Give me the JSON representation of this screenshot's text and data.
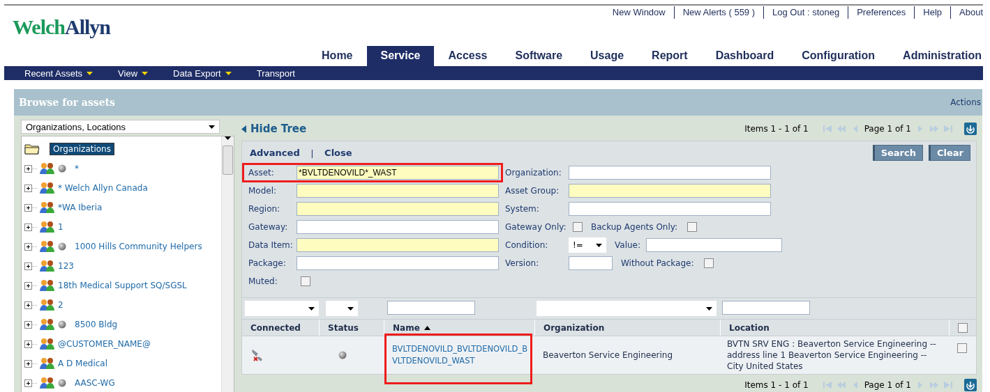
{
  "logo": [
    "Welch",
    "Allyn"
  ],
  "top_links": [
    "New Window",
    "New Alerts ( 559 )",
    "Log Out : stoneg",
    "Preferences",
    "Help",
    "About"
  ],
  "main_nav": [
    {
      "label": "Home",
      "selected": false
    },
    {
      "label": "Service",
      "selected": true
    },
    {
      "label": "Access",
      "selected": false
    },
    {
      "label": "Software",
      "selected": false
    },
    {
      "label": "Usage",
      "selected": false
    },
    {
      "label": "Report",
      "selected": false
    },
    {
      "label": "Dashboard",
      "selected": false
    },
    {
      "label": "Configuration",
      "selected": false
    },
    {
      "label": "Administration",
      "selected": false
    }
  ],
  "sub_nav": [
    {
      "label": "Recent Assets",
      "dropdown": true
    },
    {
      "label": "View",
      "dropdown": true
    },
    {
      "label": "Data Export",
      "dropdown": true
    },
    {
      "label": "Transport",
      "dropdown": false
    }
  ],
  "panel": {
    "title": "Browse for assets",
    "actions": "Actions"
  },
  "tree_selector": {
    "value": "Organizations, Locations"
  },
  "tree": {
    "root": {
      "label": "Organizations",
      "selected": true
    },
    "items": [
      {
        "label": "*",
        "status_dot": true
      },
      {
        "label": "* Welch Allyn Canada",
        "status_dot": false
      },
      {
        "label": "*WA Iberia",
        "status_dot": false
      },
      {
        "label": "1",
        "status_dot": false
      },
      {
        "label": "1000 Hills Community Helpers",
        "status_dot": true
      },
      {
        "label": "123",
        "status_dot": false
      },
      {
        "label": "18th Medical Support SQ/SGSL",
        "status_dot": false
      },
      {
        "label": "2",
        "status_dot": false
      },
      {
        "label": "8500 Bldg",
        "status_dot": true
      },
      {
        "label": "@CUSTOMER_NAME@",
        "status_dot": false
      },
      {
        "label": "A D Medical",
        "status_dot": false
      },
      {
        "label": "AASC-WG",
        "status_dot": true
      }
    ]
  },
  "hide_tree": "Hide Tree",
  "top_pager": {
    "items": "Items 1 - 1 of 1",
    "page": "Page 1 of 1"
  },
  "search_form": {
    "links": [
      "Advanced",
      "Close"
    ],
    "separator": "|",
    "buttons": [
      "Search",
      "Clear"
    ],
    "rows": [
      {
        "left": {
          "label": "Asset:",
          "kind": "text",
          "value": "*BVLTDENOVILD*_WAST",
          "shaded": true,
          "highlighted": true
        },
        "right": {
          "label": "Organization:",
          "controls": [
            {
              "kind": "text",
              "shaded": false
            }
          ]
        }
      },
      {
        "left": {
          "label": "Model:",
          "kind": "text",
          "shaded": true,
          "highlighted": false
        },
        "right": {
          "label": "Asset Group:",
          "controls": [
            {
              "kind": "text",
              "shaded": true
            }
          ]
        }
      },
      {
        "left": {
          "label": "Region:",
          "kind": "text",
          "shaded": true,
          "highlighted": false
        },
        "right": {
          "label": "System:",
          "controls": [
            {
              "kind": "text",
              "shaded": false
            }
          ]
        }
      },
      {
        "left": {
          "label": "Gateway:",
          "kind": "text",
          "shaded": false,
          "highlighted": false
        },
        "right": {
          "label": "Gateway Only:",
          "controls": [
            {
              "kind": "checkbox",
              "checked": false
            },
            {
              "kind": "label",
              "text": "Backup Agents Only:"
            },
            {
              "kind": "checkbox",
              "checked": false
            }
          ]
        }
      },
      {
        "left": {
          "label": "Data Item:",
          "kind": "text",
          "shaded": true,
          "highlighted": false
        },
        "right": {
          "label": "Condition:",
          "controls": [
            {
              "kind": "select",
              "value": "!="
            },
            {
              "kind": "label",
              "text": "Value:"
            },
            {
              "kind": "text",
              "shaded": false
            }
          ]
        }
      },
      {
        "left": {
          "label": "Package:",
          "kind": "text",
          "shaded": false,
          "highlighted": false
        },
        "right": {
          "label": "Version:",
          "controls": [
            {
              "kind": "text",
              "shaded": false
            },
            {
              "kind": "label",
              "text": "Without Package:"
            },
            {
              "kind": "checkbox",
              "checked": false
            }
          ]
        }
      },
      {
        "left": {
          "label": "Muted:",
          "kind": "checkbox",
          "checked": false,
          "highlighted": false
        }
      }
    ]
  },
  "table": {
    "columns": [
      {
        "label": "Connected",
        "filter": {
          "kind": "select"
        },
        "sorted": false
      },
      {
        "label": "Status",
        "filter": {
          "kind": "select"
        },
        "sorted": false
      },
      {
        "label": "Name",
        "filter": {
          "kind": "text"
        },
        "sorted": true
      },
      {
        "label": "Organization",
        "filter": {
          "kind": "select"
        },
        "sorted": false
      },
      {
        "label": "Location",
        "filter": {
          "kind": "text"
        },
        "sorted": false
      }
    ],
    "select_all": {
      "checked": false
    },
    "rows": [
      {
        "connected": false,
        "name": "BVLTDENOVILD_BVLTDENOVILD_BVLTDENOVILD_WAST",
        "name_highlighted": true,
        "organization": "Beaverton Service Engineering",
        "location": "BVTN SRV ENG :  Beaverton Service Engineering -- address line 1   Beaverton Service Engineering -- City   United States",
        "checked": false
      }
    ]
  },
  "bottom_pager": {
    "items": "Items 1 - 1 of 1",
    "page": "Page 1 of 1"
  }
}
